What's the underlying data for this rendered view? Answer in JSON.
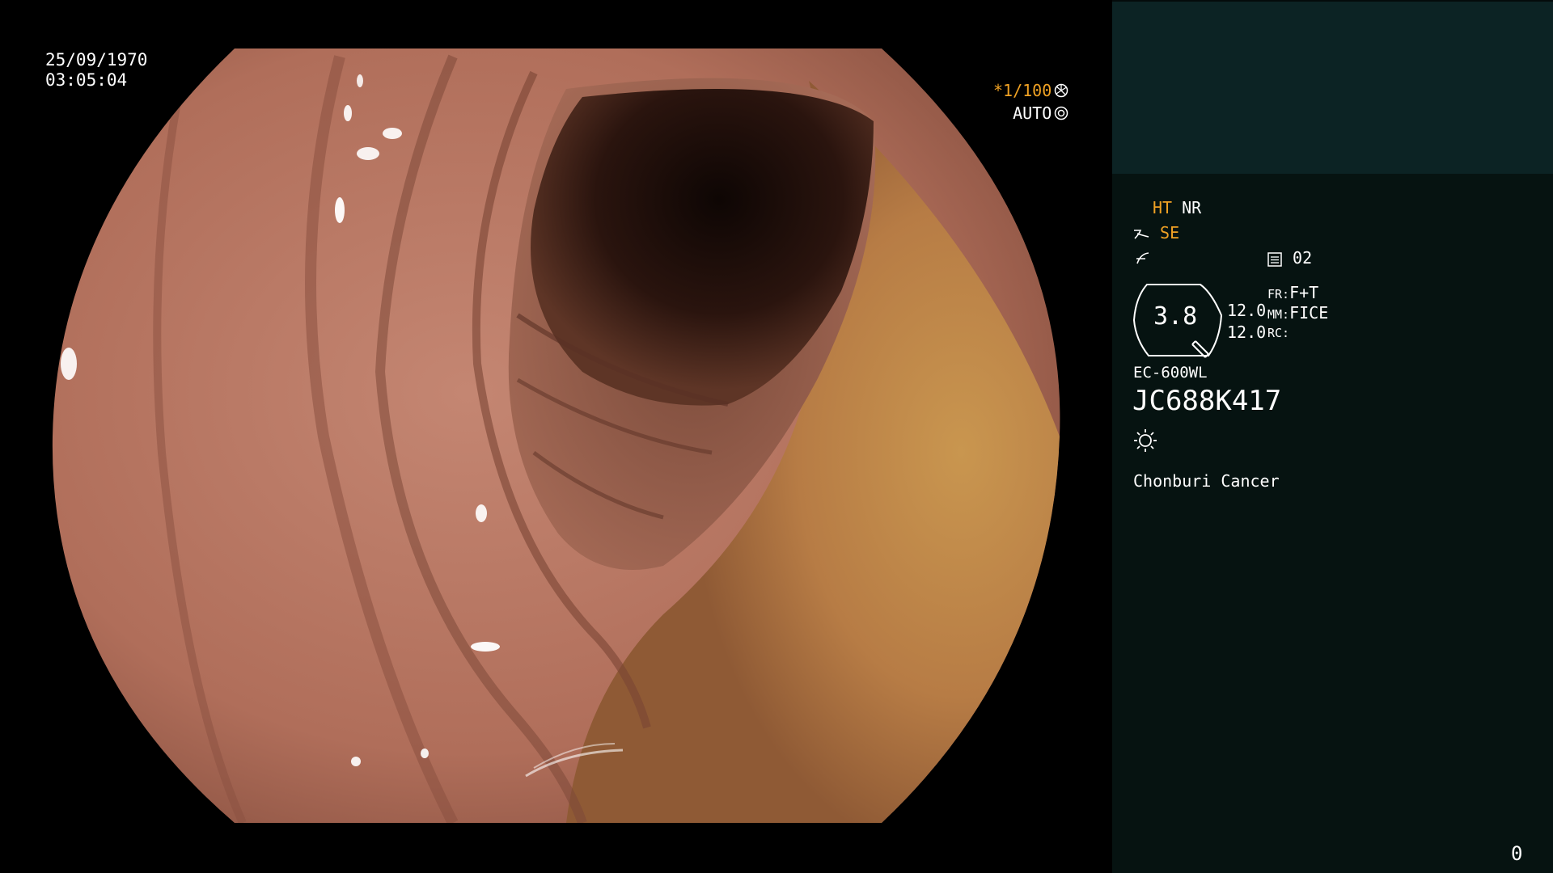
{
  "overlay": {
    "date": "25/09/1970",
    "time": "03:05:04",
    "shutter": "*1/100",
    "iris": "AUTO"
  },
  "panel": {
    "ht": "HT",
    "nr": "NR",
    "se": "SE",
    "memory": "02",
    "zoom": "3.8",
    "val1": "12.0",
    "val2": "12.0",
    "fr_label": "FR:",
    "fr_value": "F+T",
    "mm_label": "MM:",
    "mm_value": "FICE",
    "rc_label": "RC:",
    "scope_model": "EC-600WL",
    "scope_serial": "JC688K417",
    "institution": "Chonburi Cancer",
    "counter": "0"
  },
  "colors": {
    "accent_orange": "#f0a224",
    "panel_bg": "#061311",
    "panel_top_bg": "#0c2324"
  },
  "icons": [
    "shutter-icon",
    "iris-icon",
    "structure-enhance-icon",
    "color-enhance-icon",
    "memory-icon",
    "zoom-icon",
    "light-icon"
  ]
}
